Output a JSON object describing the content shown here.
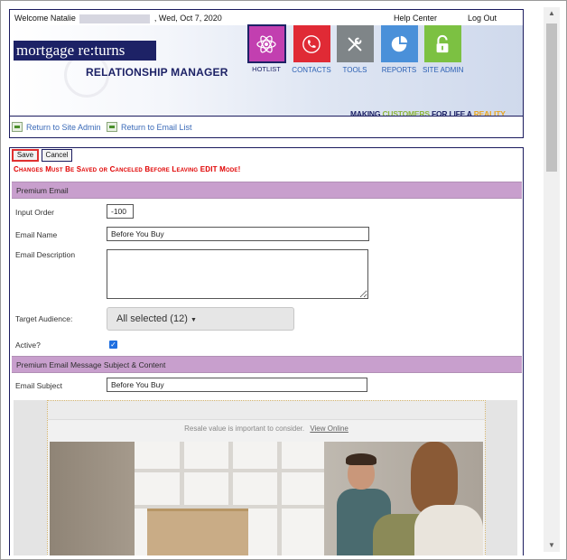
{
  "header": {
    "welcome_prefix": "Welcome Natalie",
    "welcome_date": ", Wed, Oct 7, 2020",
    "help_center": "Help Center",
    "log_out": "Log Out"
  },
  "brand": {
    "logo_text": "mortgage re:turns",
    "product_name": "RELATIONSHIP MANAGER",
    "tagline_part1": "MAKING ",
    "tagline_part2": "CUSTOMERS",
    "tagline_part3": " FOR LIFE A ",
    "tagline_part4": "REALITY",
    "colors": {
      "navy": "#1d2266",
      "green": "#8cb43c",
      "orange": "#e7a521"
    }
  },
  "nav": {
    "items": [
      {
        "label": "HOTLIST",
        "icon": "atom-icon",
        "color": "#c23fb0"
      },
      {
        "label": "CONTACTS",
        "icon": "phone-icon",
        "color": "#e02a35"
      },
      {
        "label": "TOOLS",
        "icon": "wrench-screwdriver-icon",
        "color": "#7f8588"
      },
      {
        "label": "REPORTS",
        "icon": "pie-chart-icon",
        "color": "#4a90d9"
      },
      {
        "label": "SITE ADMIN",
        "icon": "lock-icon",
        "color": "#7cc142"
      }
    ]
  },
  "links": {
    "return_site_admin": "Return to Site Admin",
    "return_email_list": "Return to Email List"
  },
  "edit": {
    "save_label": "Save",
    "cancel_label": "Cancel",
    "warning": "Changes Must Be Saved or Canceled Before Leaving EDIT Mode!"
  },
  "section_premium_email": {
    "title": "Premium Email",
    "input_order_label": "Input Order",
    "input_order_value": "-100",
    "email_name_label": "Email Name",
    "email_name_value": "Before You Buy",
    "email_description_label": "Email Description",
    "email_description_value": "",
    "target_audience_label": "Target Audience:",
    "target_audience_value": "All selected (12)",
    "active_label": "Active?",
    "active_checked": true
  },
  "section_subject": {
    "title": "Premium Email Message Subject & Content",
    "email_subject_label": "Email Subject",
    "email_subject_value": "Before You Buy"
  },
  "preview": {
    "preheader": "Resale value is important to consider.",
    "view_online": "View Online"
  }
}
